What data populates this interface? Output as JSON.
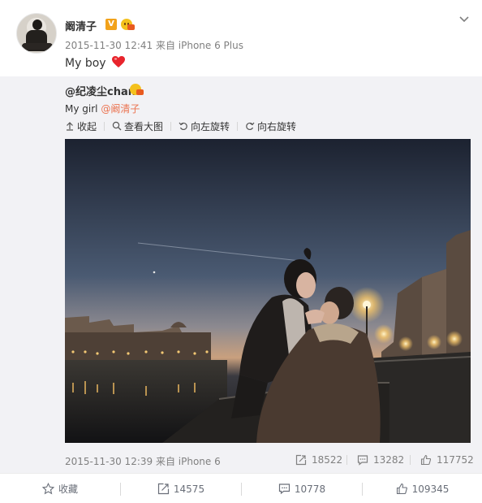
{
  "post": {
    "author": "阚清子",
    "verified_badge": "V",
    "timestamp": "2015-11-30 12:41 来自 iPhone 6 Plus",
    "text": "My boy"
  },
  "repost": {
    "author": "@纪凌尘chan",
    "text_prefix": "My girl ",
    "mention": "@阚清子",
    "toolbar": {
      "collapse": "收起",
      "view_large": "查看大图",
      "rotate_left": "向左旋转",
      "rotate_right": "向右旋转"
    },
    "timestamp": "2015-11-30 12:39 来自 iPhone 6",
    "reposts": "18522",
    "comments": "13282",
    "likes": "117752"
  },
  "bottom_bar": {
    "favorite": "收藏",
    "reposts": "14575",
    "comments": "10778",
    "likes": "109345"
  },
  "icons": {
    "chevron": "chevron-down-icon",
    "heart": "heart-icon",
    "collapse": "collapse-arrow-icon",
    "view_large": "magnifier-icon",
    "rotate_left": "rotate-left-icon",
    "rotate_right": "rotate-right-icon",
    "repost": "repost-icon",
    "comment": "comment-icon",
    "like": "thumbs-up-icon",
    "favorite": "star-icon"
  },
  "colors": {
    "mention": "#eb7350",
    "verified": "#f2a21a",
    "heart": "#e8242c",
    "meta_gray": "#808080",
    "repost_bg": "#f2f2f5"
  }
}
